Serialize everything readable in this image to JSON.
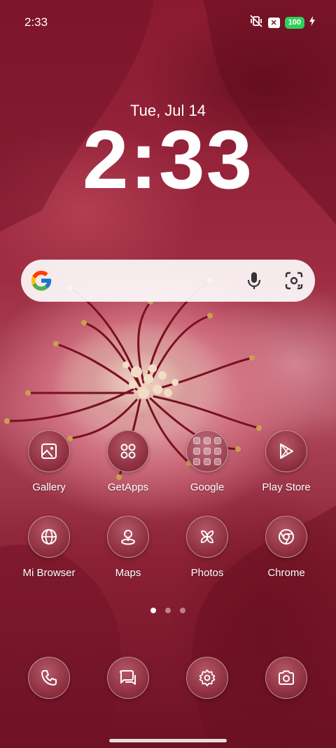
{
  "status_bar": {
    "time": "2:33",
    "battery": "100",
    "icons": [
      "mute-vibrate-icon",
      "x-notification-icon",
      "battery-icon",
      "charging-icon"
    ]
  },
  "lockscreen": {
    "date": "Tue, Jul 14",
    "clock": "2:33"
  },
  "search_bar": {
    "icons": [
      "google-g-icon",
      "mic-icon",
      "lens-icon"
    ]
  },
  "apps_row1": [
    {
      "label": "Gallery",
      "icon": "gallery-icon"
    },
    {
      "label": "GetApps",
      "icon": "getapps-icon"
    },
    {
      "label": "Google",
      "icon": "folder-icon"
    },
    {
      "label": "Play Store",
      "icon": "play-store-icon"
    }
  ],
  "apps_row2": [
    {
      "label": "Mi Browser",
      "icon": "globe-icon"
    },
    {
      "label": "Maps",
      "icon": "map-pin-icon"
    },
    {
      "label": "Photos",
      "icon": "pinwheel-icon"
    },
    {
      "label": "Chrome",
      "icon": "chrome-icon"
    }
  ],
  "dock": [
    {
      "icon": "phone-icon"
    },
    {
      "icon": "messages-icon"
    },
    {
      "icon": "settings-icon"
    },
    {
      "icon": "camera-icon"
    }
  ],
  "page_indicator": {
    "pages": 3,
    "current": 1
  },
  "colors": {
    "accent": "#7a1426",
    "battery_green": "#2fd05a",
    "icon_bg": "#8a2c3c"
  }
}
